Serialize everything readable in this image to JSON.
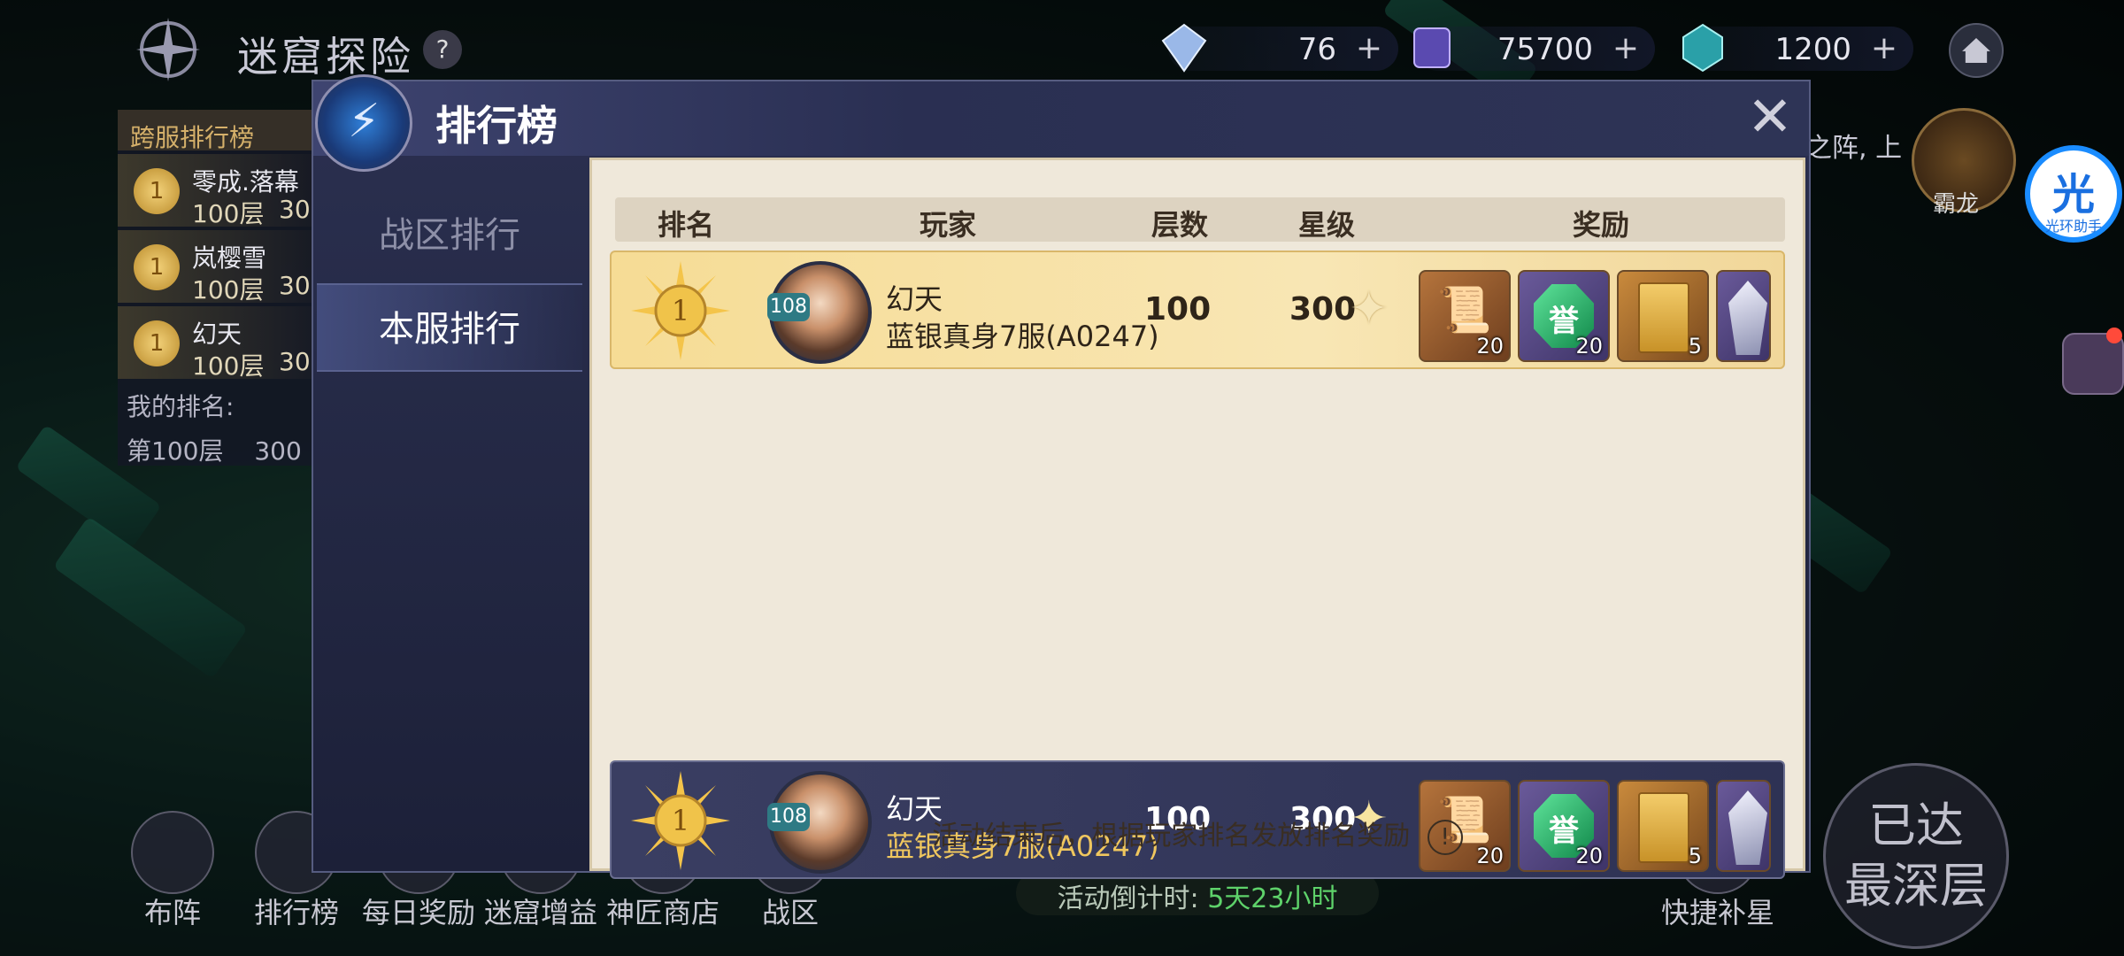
{
  "topbar": {
    "title": "迷窟探险",
    "help": "?",
    "currencies": [
      {
        "icon": "diamond-icon",
        "value": "76",
        "plus": "+"
      },
      {
        "icon": "purple-gem-icon",
        "value": "75700",
        "plus": "+"
      },
      {
        "icon": "teal-gem-icon",
        "value": "1200",
        "plus": "+"
      }
    ],
    "home_icon": "home-icon"
  },
  "left_panel": {
    "header": "跨服排行榜",
    "rows": [
      {
        "rank": "1",
        "name": "零成.落幕",
        "floor": "100层",
        "score": "30"
      },
      {
        "rank": "1",
        "name": "岚樱雪",
        "floor": "100层",
        "score": "30"
      },
      {
        "rank": "1",
        "name": "幻天",
        "floor": "100层",
        "score": "30"
      }
    ],
    "my_rank_label": "我的排名:",
    "my_floor": "第100层",
    "my_score": "300"
  },
  "right_side": {
    "text": "之阵, 上",
    "boss_label": "霸龙",
    "assist_glyph": "光",
    "assist_label": "光环助手",
    "deepest_line1": "已达",
    "deepest_line2": "最深层"
  },
  "bottom_nav": [
    {
      "label": "布阵",
      "icon": "formation-icon"
    },
    {
      "label": "排行榜",
      "icon": "trophy-icon"
    },
    {
      "label": "每日奖励",
      "icon": "gift-icon"
    },
    {
      "label": "迷窟增益",
      "icon": "buff-icon"
    },
    {
      "label": "神匠商店",
      "icon": "shop-icon"
    },
    {
      "label": "战区",
      "icon": "battlezone-icon"
    },
    {
      "label": "快捷补星",
      "icon": "star-refill-icon"
    }
  ],
  "countdown": {
    "label": "活动倒计时:",
    "value": "5天23小时"
  },
  "modal": {
    "title": "排行榜",
    "close": "✕",
    "tabs": [
      {
        "label": "战区排行",
        "active": false
      },
      {
        "label": "本服排行",
        "active": true
      }
    ],
    "columns": {
      "rank": "排名",
      "player": "玩家",
      "floors": "层数",
      "stars": "星级",
      "rewards": "奖励"
    },
    "rows": [
      {
        "rank": "1",
        "level": "108",
        "name": "幻天",
        "server": "蓝银真身7服(A0247)",
        "floors": "100",
        "stars": "300",
        "rewards": [
          {
            "type": "scroll",
            "count": "20"
          },
          {
            "type": "honor-gem",
            "glyph": "誉",
            "count": "20"
          },
          {
            "type": "book",
            "count": "5"
          },
          {
            "type": "crystal",
            "count": ""
          }
        ]
      }
    ],
    "mine": {
      "rank": "1",
      "level": "108",
      "name": "幻天",
      "server": "蓝银真身7服(A0247)",
      "floors": "100",
      "stars": "300",
      "rewards": [
        {
          "type": "scroll",
          "count": "20"
        },
        {
          "type": "honor-gem",
          "glyph": "誉",
          "count": "20"
        },
        {
          "type": "book",
          "count": "5"
        },
        {
          "type": "crystal",
          "count": ""
        }
      ]
    },
    "notice": "活动结束后，根据玩家排名发放排名奖励",
    "notice_icon": "!"
  },
  "colors": {
    "accent_gold": "#f0c75e",
    "countdown_green": "#5ed26a",
    "panel_bg": "#efe8da"
  }
}
